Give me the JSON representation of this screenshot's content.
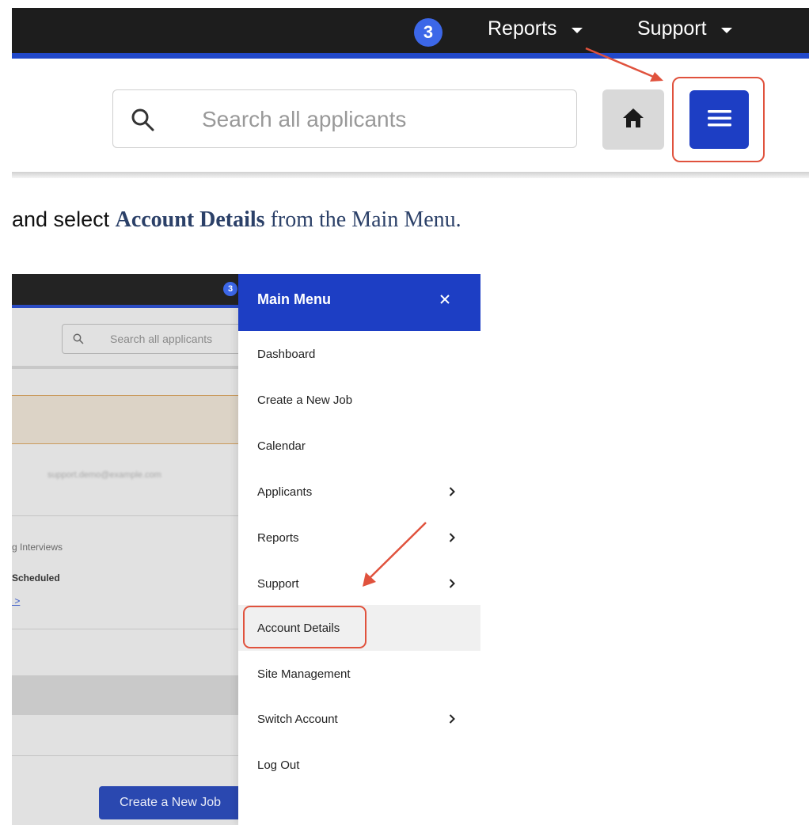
{
  "top_screenshot": {
    "notification_count": "3",
    "nav": {
      "reports_label": "Reports",
      "support_label": "Support"
    },
    "search": {
      "placeholder": "Search all applicants"
    },
    "icons": {
      "search": "search-icon",
      "home": "home-icon",
      "menu": "hamburger-menu-icon"
    }
  },
  "instruction": {
    "prefix": "and select ",
    "target": "Account Details",
    "suffix": " from the Main Menu."
  },
  "bottom_screenshot": {
    "background": {
      "notification_count": "3",
      "search_placeholder": "Search all applicants",
      "interviews_label": "g Interviews",
      "scheduled_label": "Scheduled",
      "link_text": "<u> ></u>",
      "create_job_label": "Create a New Job"
    },
    "main_menu": {
      "title": "Main Menu",
      "items": [
        {
          "label": "Dashboard",
          "has_submenu": false
        },
        {
          "label": "Create a New Job",
          "has_submenu": false
        },
        {
          "label": "Calendar",
          "has_submenu": false
        },
        {
          "label": "Applicants",
          "has_submenu": true
        },
        {
          "label": "Reports",
          "has_submenu": true
        },
        {
          "label": "Support",
          "has_submenu": true
        },
        {
          "label": "Account Details",
          "has_submenu": false,
          "highlighted": true
        },
        {
          "label": "Site Management",
          "has_submenu": false
        },
        {
          "label": "Switch Account",
          "has_submenu": true
        },
        {
          "label": "Log Out",
          "has_submenu": false
        }
      ]
    }
  },
  "colors": {
    "brand_blue": "#1d3ec4",
    "nav_dark": "#1d1d1d",
    "annotation_red": "#e0523d",
    "badge_blue": "#3c67e8"
  }
}
